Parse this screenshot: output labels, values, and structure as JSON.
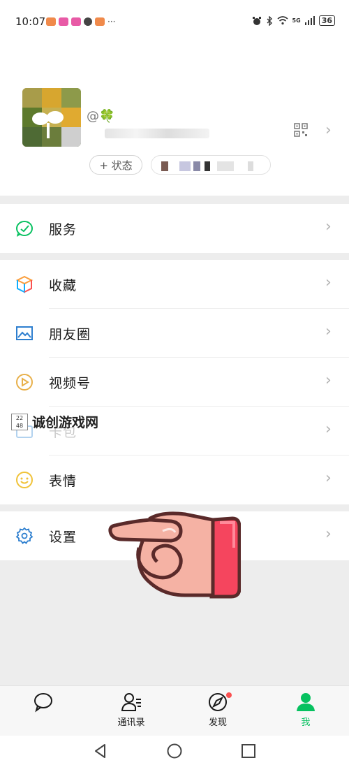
{
  "status_bar": {
    "time": "10:07",
    "more": "···",
    "signal": "5G",
    "battery": "36"
  },
  "profile": {
    "nickname_decoration": "@🍀",
    "status_button_label": "+ 状态"
  },
  "menu": {
    "service": {
      "label": "服务",
      "icon": "service-icon"
    },
    "favorites": {
      "label": "收藏",
      "icon": "favorites-cube-icon"
    },
    "moments": {
      "label": "朋友圈",
      "icon": "moments-image-icon"
    },
    "channels": {
      "label": "视频号",
      "icon": "channels-play-icon"
    },
    "cards": {
      "label": "卡包",
      "icon": "card-wallet-icon"
    },
    "stickers": {
      "label": "表情",
      "icon": "smiley-icon"
    },
    "settings": {
      "label": "设置",
      "icon": "gear-icon"
    }
  },
  "watermark": {
    "box_text": "22 48",
    "text": "诚创游戏网"
  },
  "tabbar": {
    "chats": {
      "label": ""
    },
    "contacts": {
      "label": "通讯录"
    },
    "discover": {
      "label": "发现"
    },
    "me": {
      "label": "我"
    }
  },
  "colors": {
    "accent_green": "#07c160",
    "badge_red": "#fa5151",
    "arrow_gray": "#b2b2b2",
    "bg_gray": "#ededed"
  }
}
